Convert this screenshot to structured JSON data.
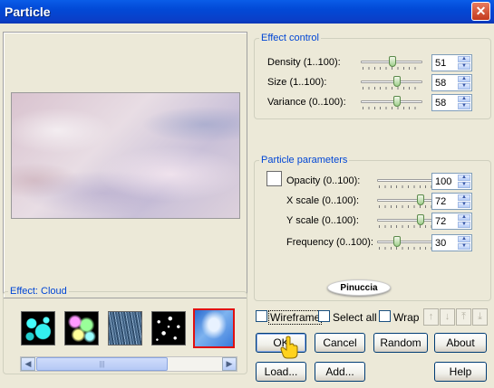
{
  "window": {
    "title": "Particle"
  },
  "preview": {},
  "effect_group": {
    "legend": "Effect: Cloud",
    "thumbnails": [
      "bubbles",
      "glow-spheres",
      "rain",
      "stars",
      "cloud"
    ],
    "selected_index": 4
  },
  "effect_control": {
    "legend": "Effect control",
    "rows": [
      {
        "label": "Density (1..100):",
        "value": "51"
      },
      {
        "label": "Size (1..100):",
        "value": "58"
      },
      {
        "label": "Variance (0..100):",
        "value": "58"
      }
    ]
  },
  "particle_parameters": {
    "legend": "Particle parameters",
    "rows": [
      {
        "label": "Opacity (0..100):",
        "value": "100"
      },
      {
        "label": "X scale (0..100):",
        "value": "72"
      },
      {
        "label": "Y scale (0..100):",
        "value": "72"
      },
      {
        "label": "Frequency (0..100):",
        "value": "30"
      }
    ]
  },
  "logo_text": "Pinuccia",
  "options": {
    "wireframe": "Wireframe",
    "select_all": "Select all",
    "wrap": "Wrap"
  },
  "buttons": {
    "ok": "OK",
    "cancel": "Cancel",
    "random": "Random",
    "about": "About",
    "load": "Load...",
    "add": "Add...",
    "help": "Help"
  },
  "colors": {
    "titlebar": "#0a5de8",
    "legend": "#0046d5",
    "selected_thumb_border": "#e01010"
  },
  "icons": [
    "close-icon",
    "arrow-up-icon",
    "arrow-down-icon",
    "move-top-icon",
    "move-bottom-icon",
    "pointing-hand-icon"
  ]
}
